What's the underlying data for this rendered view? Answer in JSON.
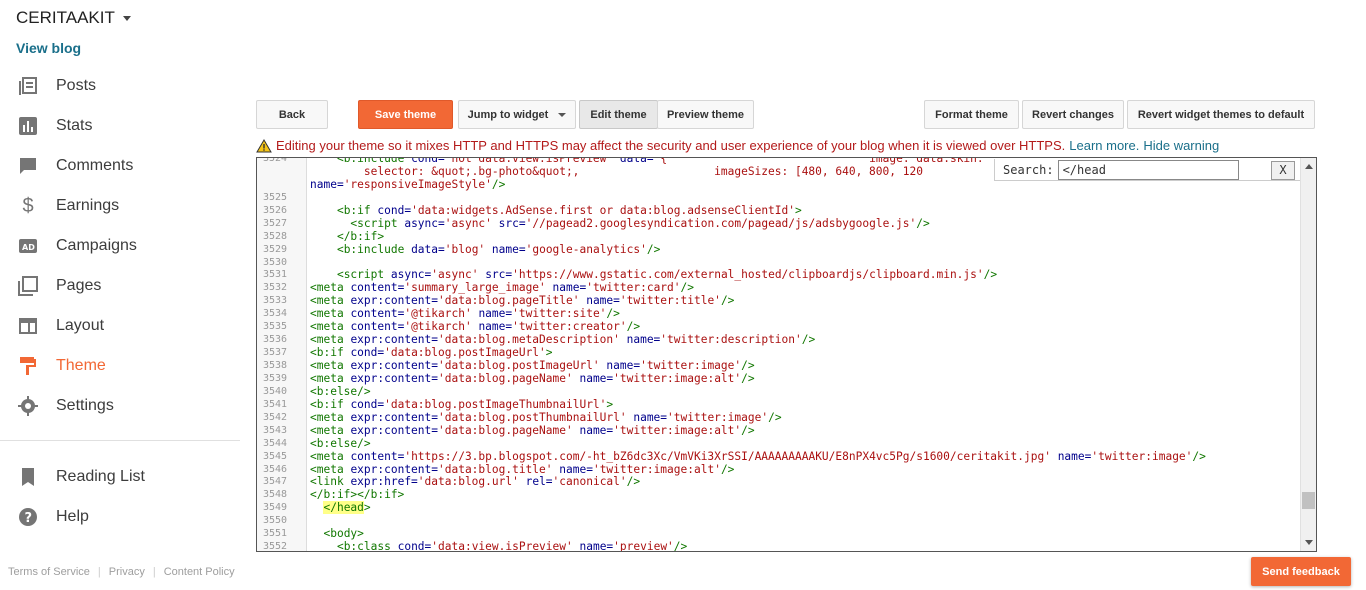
{
  "blog": {
    "title": "CERITAAKIT",
    "view_link": "View blog"
  },
  "nav": {
    "items": [
      {
        "label": "Posts",
        "icon": "posts-icon"
      },
      {
        "label": "Stats",
        "icon": "stats-icon"
      },
      {
        "label": "Comments",
        "icon": "comments-icon"
      },
      {
        "label": "Earnings",
        "icon": "dollar-icon"
      },
      {
        "label": "Campaigns",
        "icon": "campaigns-icon"
      },
      {
        "label": "Pages",
        "icon": "pages-icon"
      },
      {
        "label": "Layout",
        "icon": "layout-icon"
      },
      {
        "label": "Theme",
        "icon": "theme-icon",
        "active": true
      },
      {
        "label": "Settings",
        "icon": "gear-icon"
      }
    ],
    "secondary": [
      {
        "label": "Reading List",
        "icon": "bookmark-icon"
      },
      {
        "label": "Help",
        "icon": "help-icon"
      }
    ]
  },
  "footer": {
    "terms": "Terms of Service",
    "privacy": "Privacy",
    "content_policy": "Content Policy"
  },
  "toolbar": {
    "back": "Back",
    "save": "Save theme",
    "jump": "Jump to widget",
    "edit": "Edit theme",
    "preview": "Preview theme",
    "format": "Format theme",
    "revert": "Revert changes",
    "revert_widgets": "Revert widget themes to default"
  },
  "warning": {
    "text": "Editing your theme so it mixes HTTP and HTTPS may affect the security and user experience of your blog when it is viewed over HTTPS.",
    "learn_more": "Learn more.",
    "hide": "Hide warning"
  },
  "search": {
    "label": "Search:",
    "value": "</head",
    "close": "X"
  },
  "feedback": "Send feedback",
  "accent_color": "#f26835"
}
